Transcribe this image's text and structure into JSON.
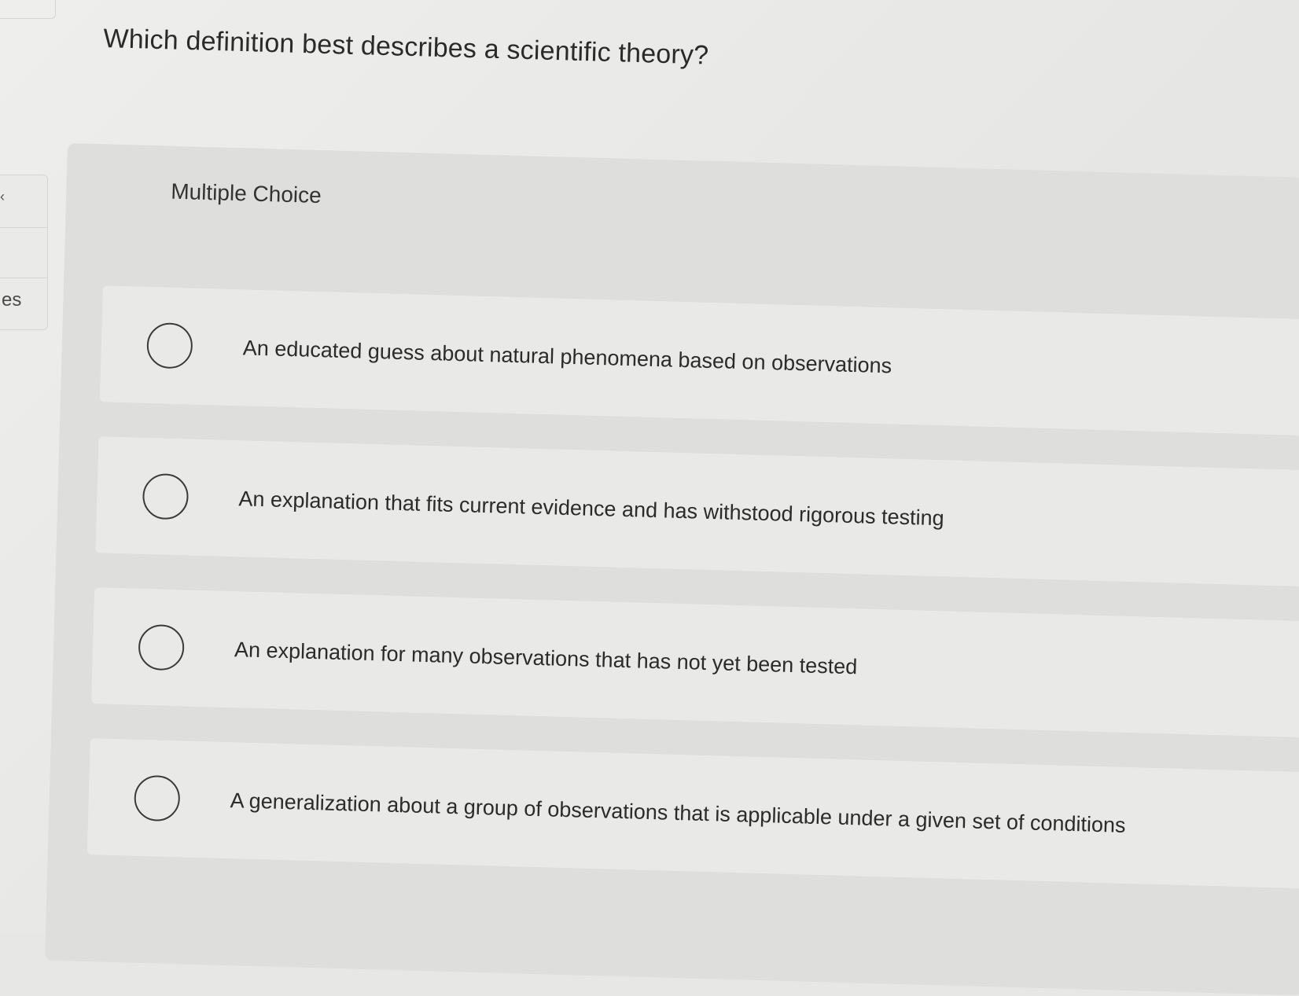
{
  "question": "Which definition best describes a scientific theory?",
  "sidebar": {
    "partial_label": "es"
  },
  "answer_type": "Multiple Choice",
  "options": [
    {
      "label": "An educated guess about natural phenomena based on observations"
    },
    {
      "label": "An explanation that fits current evidence and has withstood rigorous testing"
    },
    {
      "label": "An explanation for many observations that has not yet been tested"
    },
    {
      "label": "A generalization about a group of observations that is applicable under a given set of conditions"
    }
  ]
}
